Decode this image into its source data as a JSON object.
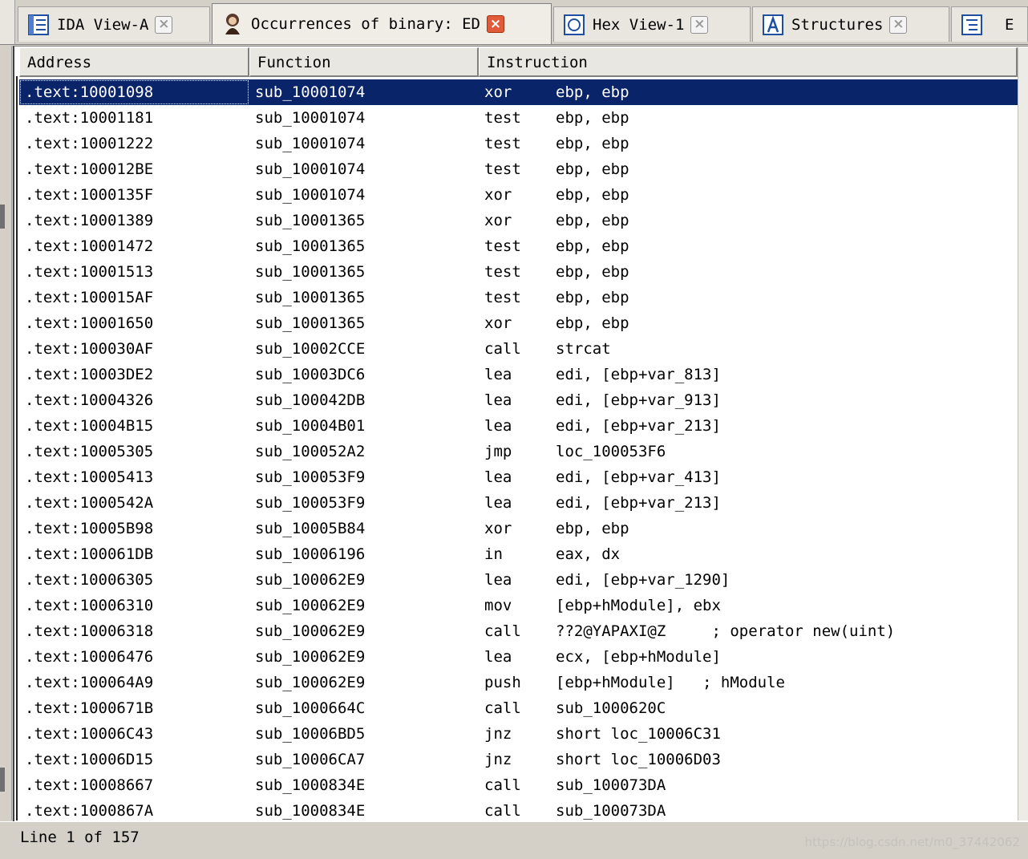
{
  "tabs": [
    {
      "label": "IDA View-A",
      "icon": "ida-view-icon",
      "close": "×"
    },
    {
      "label": "Occurrences of binary: ED",
      "icon": "occurrences-icon",
      "close": "×"
    },
    {
      "label": "Hex View-1",
      "icon": "hex-view-icon",
      "close": "×"
    },
    {
      "label": "Structures",
      "icon": "structures-icon",
      "close": "×"
    },
    {
      "label": "E",
      "icon": "enums-icon"
    }
  ],
  "columns": {
    "address": "Address",
    "function": "Function",
    "instruction": "Instruction"
  },
  "rows": [
    {
      "address": ".text:10001098",
      "function": "sub_10001074",
      "mnemonic": "xor",
      "operands": "ebp, ebp"
    },
    {
      "address": ".text:10001181",
      "function": "sub_10001074",
      "mnemonic": "test",
      "operands": "ebp, ebp"
    },
    {
      "address": ".text:10001222",
      "function": "sub_10001074",
      "mnemonic": "test",
      "operands": "ebp, ebp"
    },
    {
      "address": ".text:100012BE",
      "function": "sub_10001074",
      "mnemonic": "test",
      "operands": "ebp, ebp"
    },
    {
      "address": ".text:1000135F",
      "function": "sub_10001074",
      "mnemonic": "xor",
      "operands": "ebp, ebp"
    },
    {
      "address": ".text:10001389",
      "function": "sub_10001365",
      "mnemonic": "xor",
      "operands": "ebp, ebp"
    },
    {
      "address": ".text:10001472",
      "function": "sub_10001365",
      "mnemonic": "test",
      "operands": "ebp, ebp"
    },
    {
      "address": ".text:10001513",
      "function": "sub_10001365",
      "mnemonic": "test",
      "operands": "ebp, ebp"
    },
    {
      "address": ".text:100015AF",
      "function": "sub_10001365",
      "mnemonic": "test",
      "operands": "ebp, ebp"
    },
    {
      "address": ".text:10001650",
      "function": "sub_10001365",
      "mnemonic": "xor",
      "operands": "ebp, ebp"
    },
    {
      "address": ".text:100030AF",
      "function": "sub_10002CCE",
      "mnemonic": "call",
      "operands": "strcat"
    },
    {
      "address": ".text:10003DE2",
      "function": "sub_10003DC6",
      "mnemonic": "lea",
      "operands": "edi, [ebp+var_813]"
    },
    {
      "address": ".text:10004326",
      "function": "sub_100042DB",
      "mnemonic": "lea",
      "operands": "edi, [ebp+var_913]"
    },
    {
      "address": ".text:10004B15",
      "function": "sub_10004B01",
      "mnemonic": "lea",
      "operands": "edi, [ebp+var_213]"
    },
    {
      "address": ".text:10005305",
      "function": "sub_100052A2",
      "mnemonic": "jmp",
      "operands": "loc_100053F6"
    },
    {
      "address": ".text:10005413",
      "function": "sub_100053F9",
      "mnemonic": "lea",
      "operands": "edi, [ebp+var_413]"
    },
    {
      "address": ".text:1000542A",
      "function": "sub_100053F9",
      "mnemonic": "lea",
      "operands": "edi, [ebp+var_213]"
    },
    {
      "address": ".text:10005B98",
      "function": "sub_10005B84",
      "mnemonic": "xor",
      "operands": "ebp, ebp"
    },
    {
      "address": ".text:100061DB",
      "function": "sub_10006196",
      "mnemonic": "in",
      "operands": "eax, dx"
    },
    {
      "address": ".text:10006305",
      "function": "sub_100062E9",
      "mnemonic": "lea",
      "operands": "edi, [ebp+var_1290]"
    },
    {
      "address": ".text:10006310",
      "function": "sub_100062E9",
      "mnemonic": "mov",
      "operands": "[ebp+hModule], ebx"
    },
    {
      "address": ".text:10006318",
      "function": "sub_100062E9",
      "mnemonic": "call",
      "operands": "??2@YAPAXI@Z     ; operator new(uint)"
    },
    {
      "address": ".text:10006476",
      "function": "sub_100062E9",
      "mnemonic": "lea",
      "operands": "ecx, [ebp+hModule]"
    },
    {
      "address": ".text:100064A9",
      "function": "sub_100062E9",
      "mnemonic": "push",
      "operands": "[ebp+hModule]   ; hModule"
    },
    {
      "address": ".text:1000671B",
      "function": "sub_1000664C",
      "mnemonic": "call",
      "operands": "sub_1000620C"
    },
    {
      "address": ".text:10006C43",
      "function": "sub_10006BD5",
      "mnemonic": "jnz",
      "operands": "short loc_10006C31"
    },
    {
      "address": ".text:10006D15",
      "function": "sub_10006CA7",
      "mnemonic": "jnz",
      "operands": "short loc_10006D03"
    },
    {
      "address": ".text:10008667",
      "function": "sub_1000834E",
      "mnemonic": "call",
      "operands": "sub_100073DA"
    },
    {
      "address": ".text:1000867A",
      "function": "sub_1000834E",
      "mnemonic": "call",
      "operands": "sub_100073DA"
    }
  ],
  "status": {
    "line_text": "Line 1 of 157"
  },
  "watermark": "https://blog.csdn.net/m0_37442062",
  "colors": {
    "selection": "#0a246a",
    "tab_close_active": "#e15a39"
  }
}
